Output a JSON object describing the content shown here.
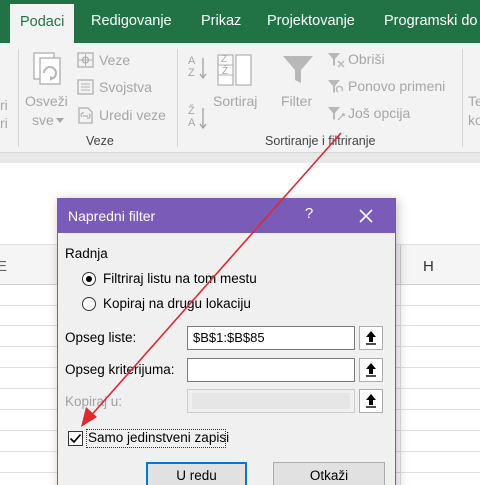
{
  "tabs": {
    "podaci": "Podaci",
    "redigovanje": "Redigovanje",
    "prikaz": "Prikaz",
    "projektovanje": "Projektovanje",
    "programski": "Programski do"
  },
  "ribbon": {
    "refresh_all": [
      "Osveži",
      "sve"
    ],
    "connections": "Veze",
    "properties": "Svojstva",
    "edit_links": "Uredi veze",
    "connections_group": "Veze",
    "sort": "Sortiraj",
    "filter": "Filter",
    "clear": "Obriši",
    "reapply": "Ponovo primeni",
    "advanced": "Još opcija",
    "sort_filter_group": "Sortiranje i filtriranje",
    "left_fragments": [
      "ri",
      "ri"
    ],
    "right_fragments": [
      "Te",
      "ko"
    ],
    "sort_icon_letters": [
      "A",
      "Z",
      "Ž",
      "A",
      "Z",
      "Ž"
    ]
  },
  "sheet": {
    "col_h": "H",
    "col_left_fragment": "E"
  },
  "dialog": {
    "title": "Napredni filter",
    "help": "?",
    "action_label": "Radnja",
    "radio_filter_in_place": "Filtriraj listu na tom mestu",
    "radio_copy": "Kopiraj na drugu lokaciju",
    "list_range_label": "Opseg liste:",
    "list_range_value": "$B$1:$B$85",
    "criteria_label": "Opseg kriterijuma:",
    "criteria_value": "",
    "copy_to_label": "Kopiraj u:",
    "unique_label": "Samo jedinstveni zapisi",
    "unique_checked": true,
    "ok": "U redu",
    "cancel": "Otkaži"
  },
  "colors": {
    "excel_green": "#217346",
    "dialog_purple": "#7b5bb8",
    "arrow_red": "#e0282e"
  }
}
